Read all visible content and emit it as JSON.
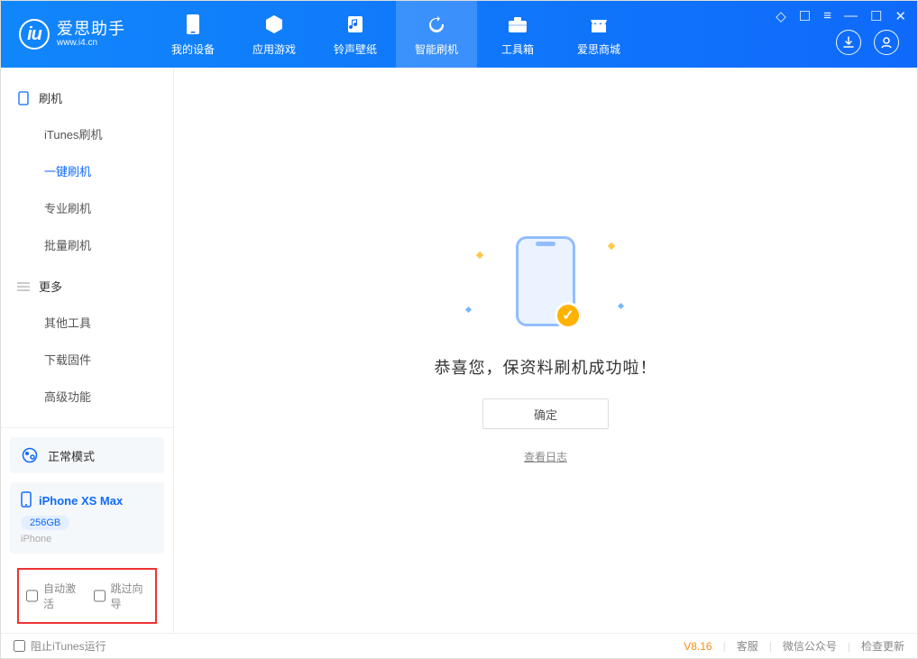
{
  "header": {
    "app_title": "爱思助手",
    "app_subtitle": "www.i4.cn",
    "tabs": [
      {
        "label": "我的设备"
      },
      {
        "label": "应用游戏"
      },
      {
        "label": "铃声壁纸"
      },
      {
        "label": "智能刷机"
      },
      {
        "label": "工具箱"
      },
      {
        "label": "爱思商城"
      }
    ]
  },
  "sidebar": {
    "group1": {
      "title": "刷机",
      "items": [
        {
          "label": "iTunes刷机"
        },
        {
          "label": "一键刷机"
        },
        {
          "label": "专业刷机"
        },
        {
          "label": "批量刷机"
        }
      ]
    },
    "group2": {
      "title": "更多",
      "items": [
        {
          "label": "其他工具"
        },
        {
          "label": "下载固件"
        },
        {
          "label": "高级功能"
        }
      ]
    },
    "mode_label": "正常模式",
    "device": {
      "name": "iPhone XS Max",
      "capacity": "256GB",
      "type": "iPhone"
    },
    "checkboxes": {
      "auto_activate": "自动激活",
      "skip_wizard": "跳过向导"
    }
  },
  "main": {
    "message": "恭喜您，保资料刷机成功啦！",
    "ok_button": "确定",
    "view_log": "查看日志"
  },
  "statusbar": {
    "block_itunes": "阻止iTunes运行",
    "version": "V8.16",
    "customer_service": "客服",
    "wechat": "微信公众号",
    "check_update": "检查更新"
  }
}
